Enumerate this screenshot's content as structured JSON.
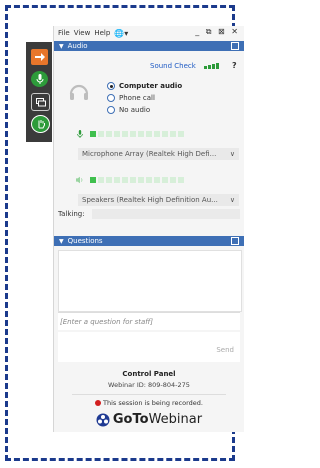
{
  "menu": {
    "file": "File",
    "view": "View",
    "help": "Help",
    "win_ctrls": "_ ⧉ ⊠ ✕"
  },
  "audio": {
    "title": "Audio",
    "sound_check": "Sound Check",
    "help": "?",
    "options": [
      {
        "label": "Computer audio",
        "selected": true
      },
      {
        "label": "Phone call",
        "selected": false
      },
      {
        "label": "No audio",
        "selected": false
      }
    ],
    "mic_level_fraction": 0.1,
    "mic_device": "Microphone Array (Realtek High Defi...",
    "speaker_level_fraction": 0.1,
    "speaker_device": "Speakers (Realtek High Definition Au...",
    "talking_label": "Talking:"
  },
  "questions": {
    "title": "Questions",
    "placeholder": "[Enter a question for staff]",
    "send": "Send"
  },
  "footer": {
    "control_panel": "Control Panel",
    "webinar_id": "Webinar ID: 809-804-275",
    "recording": "This session is being recorded.",
    "brand_go": "GoTo",
    "brand_webinar": "Webinar"
  },
  "colors": {
    "accent": "#3e6fb5",
    "green": "#2d9b3a",
    "orange": "#e8762b",
    "record": "#d21f1f",
    "border": "#1b3a8c"
  }
}
